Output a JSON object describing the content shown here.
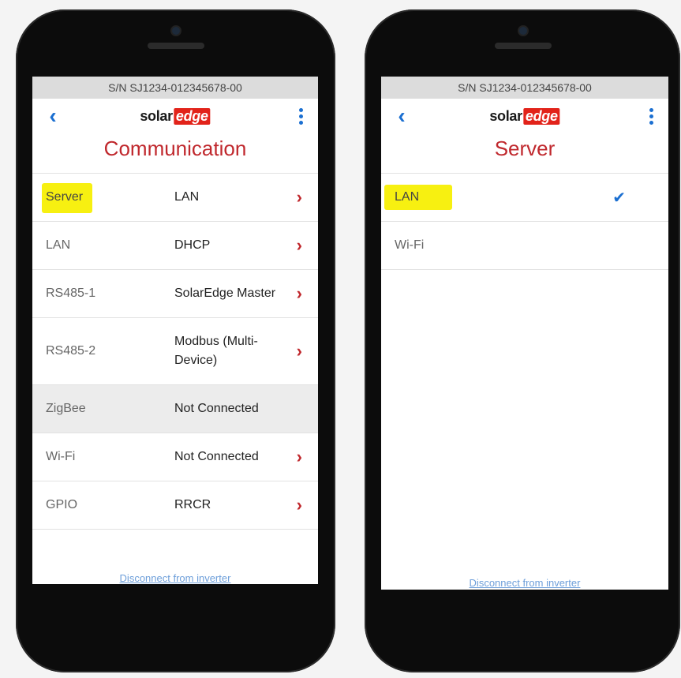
{
  "left_phone": {
    "serial": "S/N SJ1234-012345678-00",
    "logo": {
      "solar": "solar",
      "edge": "edge"
    },
    "title": "Communication",
    "rows": [
      {
        "label": "Server",
        "value": "LAN",
        "chevron": "›"
      },
      {
        "label": "LAN",
        "value": "DHCP",
        "chevron": "›"
      },
      {
        "label": "RS485-1",
        "value": "SolarEdge Master",
        "chevron": "›"
      },
      {
        "label": "RS485-2",
        "value": "Modbus (Multi-Device)",
        "chevron": "›"
      },
      {
        "label": "ZigBee",
        "value": "Not Connected",
        "chevron": ""
      },
      {
        "label": "Wi-Fi",
        "value": "Not Connected",
        "chevron": "›"
      },
      {
        "label": "GPIO",
        "value": "RRCR",
        "chevron": "›"
      }
    ],
    "footer": "Disconnect from inverter"
  },
  "right_phone": {
    "serial": "S/N SJ1234-012345678-00",
    "logo": {
      "solar": "solar",
      "edge": "edge"
    },
    "title": "Server",
    "options": [
      {
        "label": "LAN",
        "selected_mark": "✔"
      },
      {
        "label": "Wi-Fi",
        "selected_mark": ""
      }
    ],
    "footer": "Disconnect from inverter"
  },
  "icons": {
    "back": "chevron-left-icon",
    "menu": "kebab-menu-icon",
    "row_arrow": "chevron-right-icon",
    "selected": "checkmark-icon"
  },
  "colors": {
    "accent_red": "#c0282d",
    "link_blue": "#1b6fd1",
    "highlight_yellow": "#f7f011"
  }
}
